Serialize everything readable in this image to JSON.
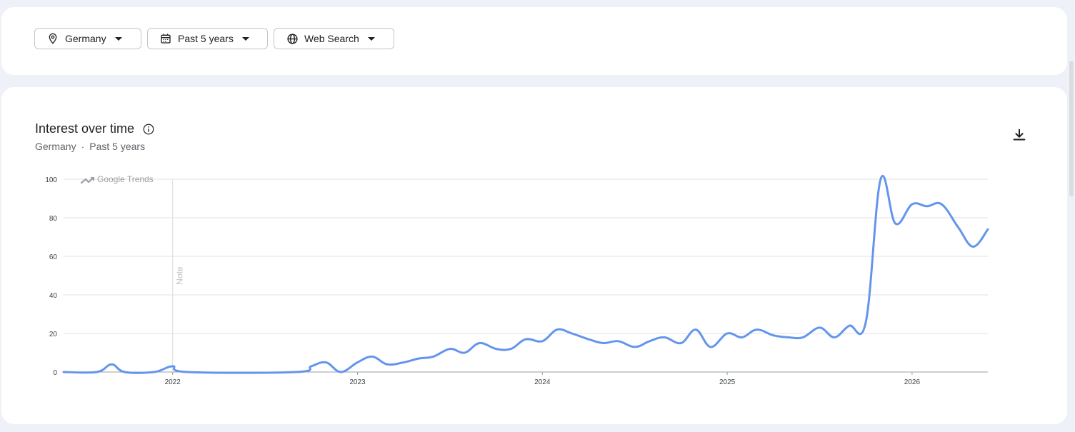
{
  "filters": {
    "region": "Germany",
    "time": "Past 5 years",
    "type": "Web Search"
  },
  "header": {
    "title": "Interest over time",
    "subtitle_region": "Germany",
    "subtitle_separator": "·",
    "subtitle_time": "Past 5 years"
  },
  "icons": {
    "location": "location-pin-icon",
    "calendar": "calendar-icon",
    "globe": "globe-icon",
    "info": "info-icon",
    "download": "download-icon"
  },
  "colors": {
    "series": "#6495ed",
    "grid": "#e0e0e0",
    "axis": "#9aa0a6"
  },
  "chart_data": {
    "type": "line",
    "watermark": "Google Trends",
    "note_label": "Note",
    "note_x": 2022.0,
    "xlim": [
      2021.41,
      2026.41
    ],
    "ylim": [
      0,
      100
    ],
    "y_ticks": [
      0,
      20,
      40,
      60,
      80,
      100
    ],
    "x_ticks": [
      2022,
      2023,
      2024,
      2025,
      2026
    ],
    "x_tick_labels": [
      "2022",
      "2023",
      "2024",
      "2025",
      "2026"
    ],
    "grid": true,
    "series": [
      {
        "values": [
          [
            2021.41,
            0
          ],
          [
            2021.59,
            0
          ],
          [
            2021.67,
            4
          ],
          [
            2021.74,
            0
          ],
          [
            2021.9,
            0
          ],
          [
            2022.0,
            3
          ],
          [
            2022.08,
            0
          ],
          [
            2022.67,
            0
          ],
          [
            2022.75,
            3
          ],
          [
            2022.83,
            5
          ],
          [
            2022.91,
            0
          ],
          [
            2023.0,
            5
          ],
          [
            2023.08,
            8
          ],
          [
            2023.16,
            4
          ],
          [
            2023.25,
            5
          ],
          [
            2023.33,
            7
          ],
          [
            2023.41,
            8
          ],
          [
            2023.5,
            12
          ],
          [
            2023.58,
            10
          ],
          [
            2023.66,
            15
          ],
          [
            2023.75,
            12
          ],
          [
            2023.83,
            12
          ],
          [
            2023.91,
            17
          ],
          [
            2024.0,
            16
          ],
          [
            2024.08,
            22
          ],
          [
            2024.16,
            20
          ],
          [
            2024.25,
            17
          ],
          [
            2024.33,
            15
          ],
          [
            2024.41,
            16
          ],
          [
            2024.5,
            13
          ],
          [
            2024.58,
            16
          ],
          [
            2024.66,
            18
          ],
          [
            2024.75,
            15
          ],
          [
            2024.83,
            22
          ],
          [
            2024.91,
            13
          ],
          [
            2025.0,
            20
          ],
          [
            2025.08,
            18
          ],
          [
            2025.16,
            22
          ],
          [
            2025.25,
            19
          ],
          [
            2025.33,
            18
          ],
          [
            2025.41,
            18
          ],
          [
            2025.5,
            23
          ],
          [
            2025.58,
            18
          ],
          [
            2025.66,
            24
          ],
          [
            2025.75,
            26
          ],
          [
            2025.83,
            100
          ],
          [
            2025.91,
            77
          ],
          [
            2026.0,
            87
          ],
          [
            2026.08,
            86
          ],
          [
            2026.16,
            87
          ],
          [
            2026.25,
            75
          ],
          [
            2026.33,
            65
          ],
          [
            2026.41,
            74
          ]
        ]
      }
    ]
  }
}
